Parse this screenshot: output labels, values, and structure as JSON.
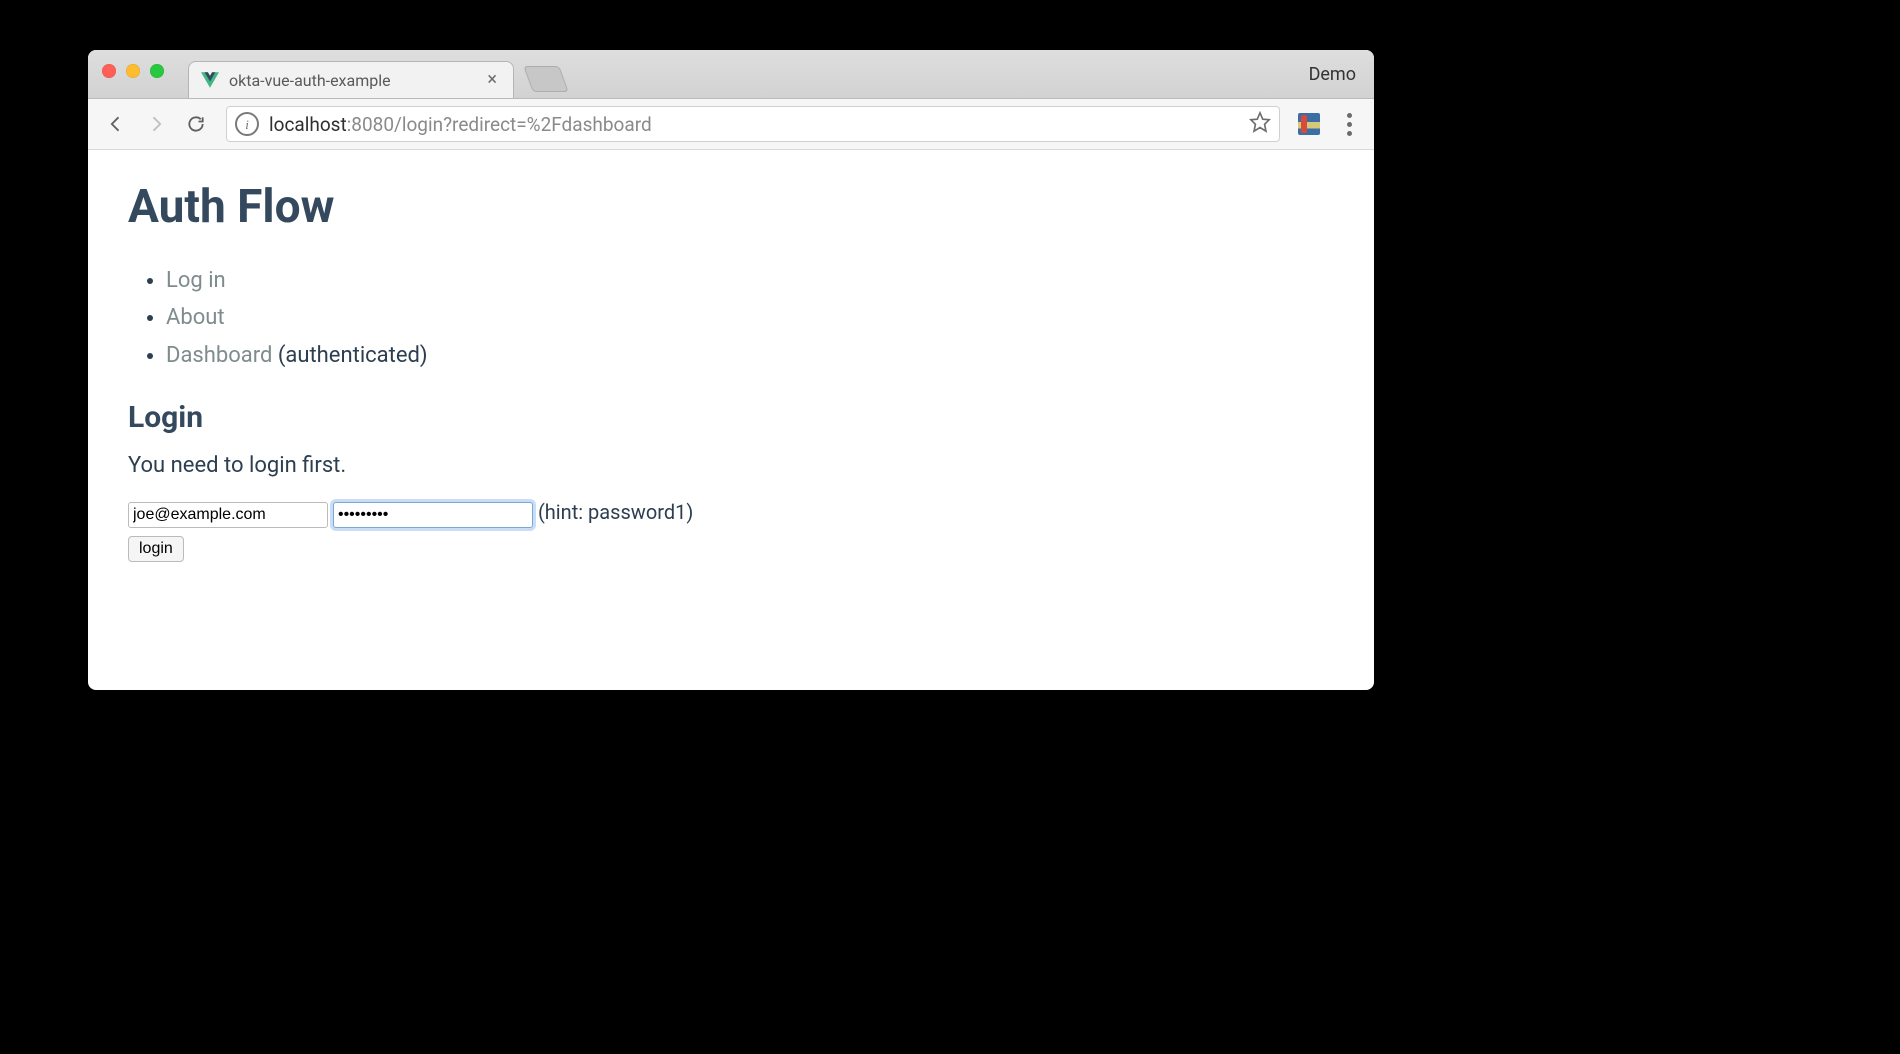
{
  "browser": {
    "tab_title": "okta-vue-auth-example",
    "watermark": "Demo",
    "url_host": "localhost",
    "url_rest": ":8080/login?redirect=%2Fdashboard"
  },
  "page": {
    "heading": "Auth Flow",
    "nav": {
      "login": "Log in",
      "about": "About",
      "dashboard": "Dashboard",
      "dashboard_suffix": " (authenticated)"
    },
    "section_heading": "Login",
    "notice": "You need to login first.",
    "form": {
      "email_value": "joe@example.com",
      "password_value": "•••••••••",
      "hint": " (hint: password1)",
      "submit_label": "login"
    }
  }
}
